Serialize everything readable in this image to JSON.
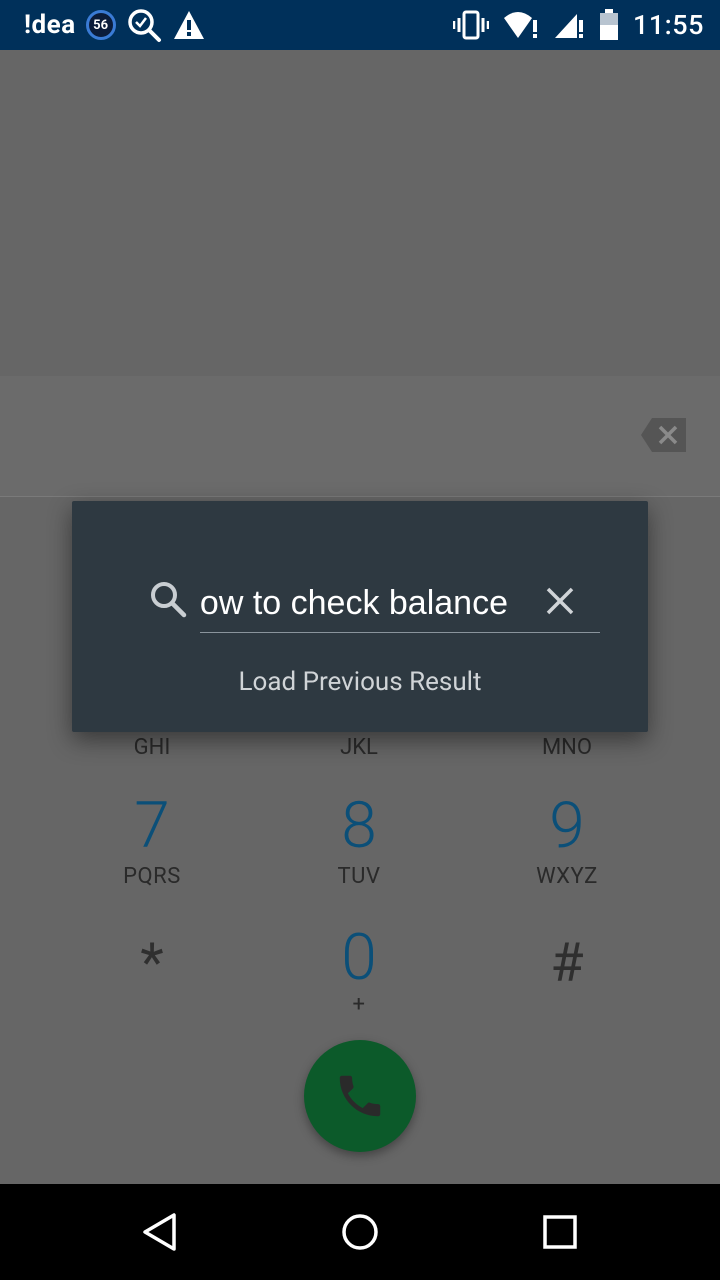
{
  "status_bar": {
    "carrier": "!dea",
    "network_badge": "56",
    "time": "11:55",
    "icons": [
      "search-location-icon",
      "warning-icon",
      "vibrate-icon",
      "wifi-alert-icon",
      "signal-alert-icon",
      "battery-icon"
    ]
  },
  "dialer": {
    "keys": [
      {
        "letters": "GHI"
      },
      {
        "letters": "JKL"
      },
      {
        "letters": "MNO"
      },
      {
        "num": "7",
        "letters": "PQRS"
      },
      {
        "num": "8",
        "letters": "TUV"
      },
      {
        "num": "9",
        "letters": "WXYZ"
      },
      {
        "sym": "*"
      },
      {
        "num": "0",
        "letters": "+"
      },
      {
        "sym": "#"
      }
    ]
  },
  "dialog": {
    "search_value": "how to check balance",
    "load_previous": "Load Previous Result"
  },
  "colors": {
    "status_bar": "#00305a",
    "dialog_bg": "#2e3941",
    "call_button": "#0c5a2a",
    "digit": "#0b4f78"
  }
}
